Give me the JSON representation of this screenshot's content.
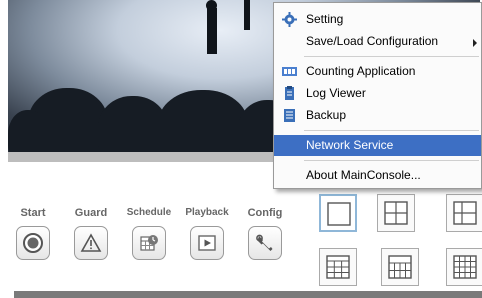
{
  "toolbar": {
    "items": [
      {
        "label": "Start",
        "icon": "record-icon"
      },
      {
        "label": "Guard",
        "icon": "warning-icon"
      },
      {
        "label": "Schedule",
        "icon": "schedule-icon"
      },
      {
        "label": "Playback",
        "icon": "play-icon"
      },
      {
        "label": "Config",
        "icon": "wrench-icon"
      }
    ]
  },
  "layouts": {
    "items": [
      "layout-1x1-icon",
      "layout-2x2-icon",
      "layout-1plus5-icon",
      "layout-3x3-icon",
      "layout-4x3-icon",
      "layout-4x4-icon"
    ],
    "selected_index": 0
  },
  "context_menu": {
    "items": [
      {
        "label": "Setting",
        "icon": "gear-icon"
      },
      {
        "label": "Save/Load Configuration",
        "has_submenu": true
      },
      {
        "label": "Counting Application",
        "icon": "counting-icon"
      },
      {
        "label": "Log Viewer",
        "icon": "log-icon"
      },
      {
        "label": "Backup",
        "icon": "backup-icon"
      },
      {
        "label": "Network Service",
        "highlighted": true
      },
      {
        "label": "About MainConsole..."
      }
    ],
    "highlight_color": "#3d6fc4"
  }
}
